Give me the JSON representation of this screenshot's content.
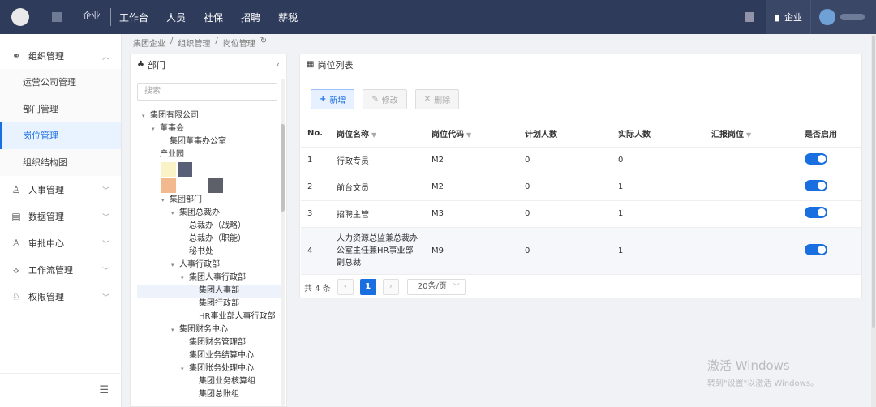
{
  "topbar": {
    "brand_suffix": "企业",
    "nav": [
      "工作台",
      "人员",
      "社保",
      "招聘",
      "薪税"
    ],
    "company": "企业"
  },
  "sidebar": {
    "groups": [
      {
        "label": "组织管理",
        "icon": "org-icon",
        "expanded": true
      },
      {
        "label": "人事管理",
        "icon": "user-icon"
      },
      {
        "label": "数据管理",
        "icon": "data-icon"
      },
      {
        "label": "审批中心",
        "icon": "approve-icon"
      },
      {
        "label": "工作流管理",
        "icon": "workflow-icon"
      },
      {
        "label": "权限管理",
        "icon": "permission-icon"
      }
    ],
    "sub_items": [
      "运营公司管理",
      "部门管理",
      "岗位管理",
      "组织结构图"
    ]
  },
  "breadcrumb": [
    "集团企业",
    "组织管理",
    "岗位管理"
  ],
  "dept": {
    "title": "部门",
    "search_placeholder": "搜索",
    "tree": [
      {
        "label": "集团有限公司",
        "indent": 0,
        "arrow": "▾"
      },
      {
        "label": "董事会",
        "indent": 1,
        "arrow": "▾"
      },
      {
        "label": "集团董事办公室",
        "indent": 2,
        "arrow": ""
      },
      {
        "label": "产业园",
        "indent": 1,
        "arrow": ""
      },
      {
        "label": "集团部门",
        "indent": 2,
        "arrow": "▾"
      },
      {
        "label": "集团总裁办",
        "indent": 3,
        "arrow": "▾"
      },
      {
        "label": "总裁办（战略）",
        "indent": 4,
        "arrow": ""
      },
      {
        "label": "总裁办（职能）",
        "indent": 4,
        "arrow": ""
      },
      {
        "label": "秘书处",
        "indent": 4,
        "arrow": ""
      },
      {
        "label": "人事行政部",
        "indent": 3,
        "arrow": "▾"
      },
      {
        "label": "集团人事行政部",
        "indent": 4,
        "arrow": "▾"
      },
      {
        "label": "集团人事部",
        "indent": 5,
        "arrow": ""
      },
      {
        "label": "集团行政部",
        "indent": 5,
        "arrow": ""
      },
      {
        "label": "HR事业部人事行政部",
        "indent": 5,
        "arrow": ""
      },
      {
        "label": "集团财务中心",
        "indent": 3,
        "arrow": "▾"
      },
      {
        "label": "集团财务管理部",
        "indent": 4,
        "arrow": ""
      },
      {
        "label": "集团业务结算中心",
        "indent": 4,
        "arrow": ""
      },
      {
        "label": "集团账务处理中心",
        "indent": 4,
        "arrow": "▾"
      },
      {
        "label": "集团业务核算组",
        "indent": 5,
        "arrow": ""
      },
      {
        "label": "集团总账组",
        "indent": 5,
        "arrow": ""
      }
    ]
  },
  "main": {
    "title": "岗位列表",
    "buttons": {
      "add": "新增",
      "edit": "修改",
      "delete": "删除"
    },
    "columns": [
      "No.",
      "岗位名称",
      "岗位代码",
      "计划人数",
      "实际人数",
      "汇报岗位",
      "是否启用"
    ],
    "rows": [
      {
        "no": "1",
        "name": "行政专员",
        "code": "M2",
        "plan": "0",
        "actual": "0",
        "report": "",
        "enabled": true
      },
      {
        "no": "2",
        "name": "前台文员",
        "code": "M2",
        "plan": "0",
        "actual": "1",
        "report": "",
        "enabled": true
      },
      {
        "no": "3",
        "name": "招聘主管",
        "code": "M3",
        "plan": "0",
        "actual": "1",
        "report": "",
        "enabled": true
      },
      {
        "no": "4",
        "name": "人力资源总监兼总裁办公室主任兼HR事业部副总裁",
        "code": "M9",
        "plan": "0",
        "actual": "1",
        "report": "",
        "enabled": true
      }
    ],
    "pager": {
      "total": "共 4 条",
      "page": "1",
      "size": "20条/页"
    }
  },
  "watermark": {
    "line1": "激活 Windows",
    "line2": "转到\"设置\"以激活 Windows。"
  }
}
